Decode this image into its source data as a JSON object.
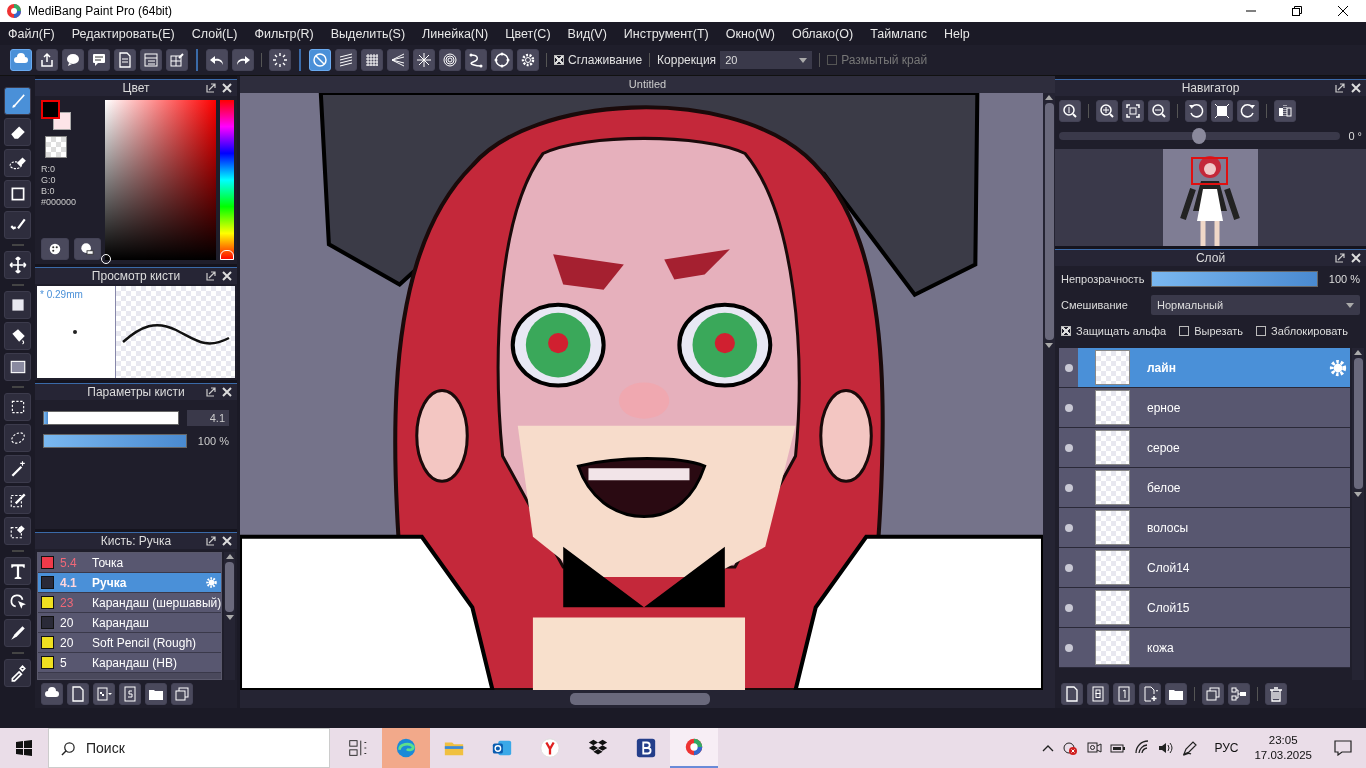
{
  "window": {
    "title": "MediBang Paint Pro (64bit)"
  },
  "menu": [
    "Файл(F)",
    "Редактировать(E)",
    "Слой(L)",
    "Фильтр(R)",
    "Выделить(S)",
    "Линейка(N)",
    "Цвет(C)",
    "Вид(V)",
    "Инструмент(T)",
    "Окно(W)",
    "Облако(O)",
    "Таймлапс",
    "Help"
  ],
  "toolbar": {
    "snap_buttons": [
      {
        "selected": true
      },
      {
        "selected": false
      },
      {
        "selected": false
      },
      {
        "selected": false
      },
      {
        "selected": false
      },
      {
        "selected": false
      },
      {
        "selected": false
      },
      {
        "selected": false
      }
    ],
    "antialias": {
      "label": "Сглаживание",
      "checked": true
    },
    "correction": {
      "label": "Коррекция",
      "value": "20"
    },
    "soft_edge": {
      "label": "Размытый край",
      "checked": false,
      "disabled": true
    }
  },
  "tools": [
    {
      "selected": true
    },
    {
      "selected": false
    },
    {
      "selected": false
    },
    {
      "selected": false
    },
    {
      "selected": false
    },
    {
      "selected": false
    },
    {
      "selected": false
    },
    {
      "selected": false
    },
    {
      "selected": false
    },
    {
      "selected": false
    },
    {
      "selected": false
    },
    {
      "selected": false
    },
    {
      "selected": false
    },
    {
      "selected": false
    },
    {
      "selected": false
    },
    {
      "selected": false
    },
    {
      "selected": false
    },
    {
      "selected": false
    }
  ],
  "color_panel": {
    "title": "Цвет",
    "r": "R:0",
    "g": "G:0",
    "b": "B:0",
    "hex": "#000000",
    "hue": {
      "level": 0
    }
  },
  "brush_preview": {
    "title": "Просмотр кисти",
    "size": "* 0.29mm"
  },
  "brush_params": {
    "title": "Параметры кисти",
    "size": {
      "level": 0.03,
      "value": "4.1"
    },
    "opacity": {
      "level": 1,
      "value": "100 %"
    }
  },
  "brush_list": {
    "title": "Кисть: Ручка",
    "items": [
      {
        "color": "#f03a4a",
        "size": "5.4",
        "size_marked": true,
        "name": "Точка",
        "selected": false
      },
      {
        "color": "#2a2a38",
        "size": "4.1",
        "size_marked": true,
        "name": "Ручка",
        "selected": true
      },
      {
        "color": "#f0e020",
        "size": "23",
        "size_marked": true,
        "name": "Карандаш (шершавый)",
        "selected": false
      },
      {
        "color": "#2a2a38",
        "size": "20",
        "size_marked": false,
        "name": "Карандаш",
        "selected": false
      },
      {
        "color": "#f0e020",
        "size": "20",
        "size_marked": false,
        "name": "Soft Pencil (Rough)",
        "selected": false
      },
      {
        "color": "#f0e020",
        "size": "5",
        "size_marked": false,
        "name": "Карандаш (HB)",
        "selected": false
      }
    ]
  },
  "canvas": {
    "tab": "Untitled"
  },
  "navigator": {
    "title": "Навигатор",
    "rotation": {
      "level": 0.5,
      "value": "0 °"
    }
  },
  "layer_panel": {
    "title": "Слой",
    "opacity": {
      "label": "Непрозрачность",
      "level": 1,
      "value": "100 %"
    },
    "blend": {
      "label": "Смешивание",
      "value": "Нормальный"
    },
    "options": [
      {
        "label": "Защищать альфа",
        "checked": true
      },
      {
        "label": "Вырезать",
        "checked": false
      },
      {
        "label": "Заблокировать",
        "checked": false
      }
    ],
    "layers": [
      {
        "name": "лайн",
        "selected": true
      },
      {
        "name": "ерное",
        "selected": false
      },
      {
        "name": "серое",
        "selected": false
      },
      {
        "name": "белое",
        "selected": false
      },
      {
        "name": "волосы",
        "selected": false
      },
      {
        "name": "Слой14",
        "selected": false
      },
      {
        "name": "Слой15",
        "selected": false
      },
      {
        "name": "кожа",
        "selected": false
      }
    ]
  },
  "taskbar": {
    "search": {
      "placeholder": "Поиск"
    },
    "apps": [
      {
        "highlighted": false,
        "selected": false
      },
      {
        "highlighted": true,
        "selected": false
      },
      {
        "highlighted": false,
        "selected": false
      },
      {
        "highlighted": false,
        "selected": false
      },
      {
        "highlighted": false,
        "selected": false
      },
      {
        "highlighted": false,
        "selected": false
      },
      {
        "highlighted": false,
        "selected": false
      },
      {
        "highlighted": false,
        "selected": true
      }
    ],
    "language": "РУС",
    "time": "23:05",
    "date": "17.03.2025"
  }
}
